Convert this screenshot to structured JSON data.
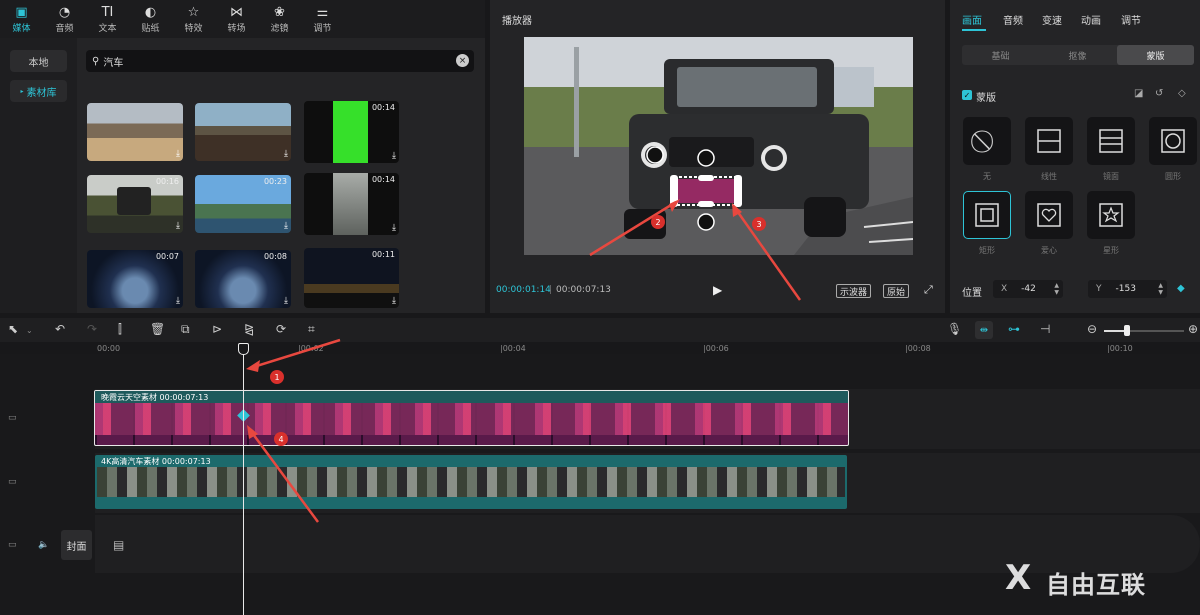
{
  "colors": {
    "accent": "#2ec4d6",
    "callout": "#d9302c",
    "arrow": "#e8483f"
  },
  "toolbar": {
    "tabs": [
      {
        "icon": "media-icon",
        "glyph": "▣",
        "label": "媒体"
      },
      {
        "icon": "audio-icon",
        "glyph": "◔",
        "label": "音频"
      },
      {
        "icon": "text-icon",
        "glyph": "TI",
        "label": "文本"
      },
      {
        "icon": "sticker-icon",
        "glyph": "◐",
        "label": "贴纸"
      },
      {
        "icon": "effect-icon",
        "glyph": "☆",
        "label": "特效"
      },
      {
        "icon": "transition-icon",
        "glyph": "⋈",
        "label": "转场"
      },
      {
        "icon": "filter-icon",
        "glyph": "❀",
        "label": "滤镜"
      },
      {
        "icon": "adjust-icon",
        "glyph": "⚌",
        "label": "调节"
      }
    ]
  },
  "side_nav": {
    "local": "本地",
    "library": "素材库"
  },
  "search": {
    "value": "汽车"
  },
  "thumbs": [
    {
      "dur": ""
    },
    {
      "dur": ""
    },
    {
      "dur": "00:14"
    },
    {
      "dur": "00:16"
    },
    {
      "dur": "00:23"
    },
    {
      "dur": "00:14"
    },
    {
      "dur": "00:07"
    },
    {
      "dur": "00:08"
    },
    {
      "dur": "00:11"
    }
  ],
  "player": {
    "title": "播放器",
    "current_time": "00:00:01:14",
    "total_time": "00:00:07:13",
    "scope_btn": "示波器",
    "original_btn": "原始"
  },
  "props": {
    "tabs": [
      "画面",
      "音频",
      "变速",
      "动画",
      "调节"
    ],
    "segments": [
      "基础",
      "抠像",
      "蒙版"
    ],
    "mask_label": "蒙版",
    "masks": [
      "无",
      "线性",
      "镜面",
      "圆形",
      "矩形",
      "爱心",
      "星形"
    ],
    "position_label": "位置",
    "x_label": "X",
    "x_value": "-42",
    "y_label": "Y",
    "y_value": "-153"
  },
  "timeline": {
    "ticks": [
      "00:00",
      "|00:02",
      "|00:04",
      "|00:06",
      "|00:08",
      "|00:10"
    ],
    "clip1_label": "晚霞云天空素材   00:00:07:13",
    "clip2_label": "4K高清汽车素材   00:00:07:13",
    "cover": "封面"
  },
  "callouts": [
    "1",
    "2",
    "3",
    "4"
  ],
  "watermark": "自由互联"
}
